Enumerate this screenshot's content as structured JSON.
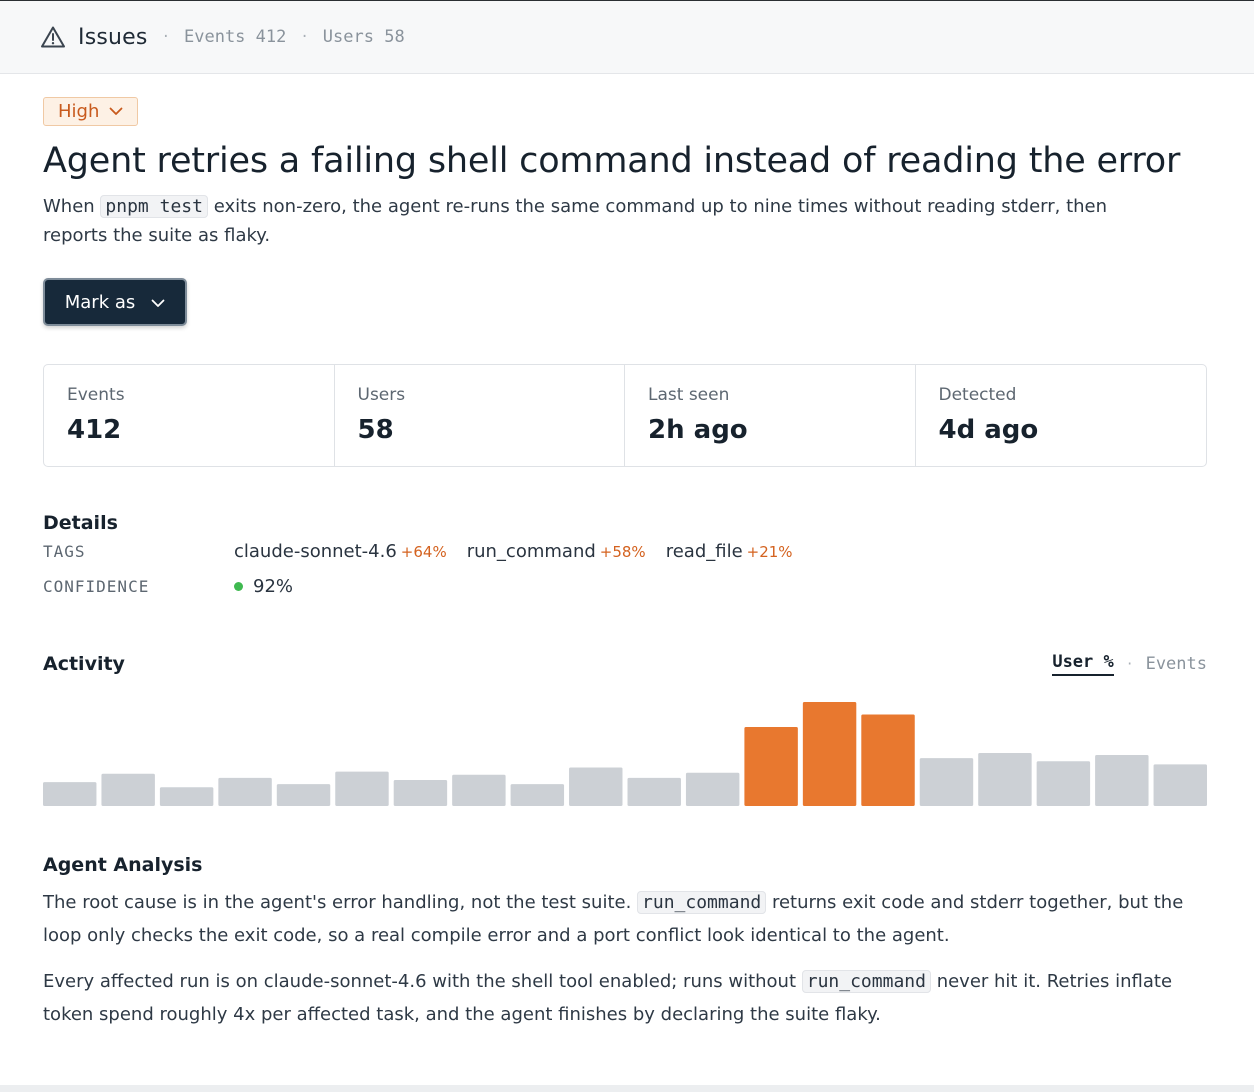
{
  "header": {
    "title": "Issues",
    "events_label": "Events 412",
    "users_label": "Users 58",
    "icon": "warning-triangle-icon"
  },
  "issue": {
    "severity": "High",
    "title": "Agent retries a failing shell command instead of reading the error",
    "desc_before": "When ",
    "desc_code": "pnpm test",
    "desc_after": " exits non-zero, the agent re-runs the same command up to nine times without reading stderr, then reports the suite as flaky.",
    "mark_button": "Mark as"
  },
  "stats": [
    {
      "label": "Events",
      "value": "412"
    },
    {
      "label": "Users",
      "value": "58"
    },
    {
      "label": "Last seen",
      "value": "2h ago"
    },
    {
      "label": "Detected",
      "value": "4d ago"
    }
  ],
  "details": {
    "title": "Details",
    "tags_key": "TAGS",
    "confidence_key": "CONFIDENCE",
    "tags": [
      {
        "name": "claude-sonnet-4.6",
        "pct": "+64%"
      },
      {
        "name": "run_command",
        "pct": "+58%"
      },
      {
        "name": "read_file",
        "pct": "+21%"
      }
    ],
    "confidence": "92%",
    "confidence_color": "#3fb950"
  },
  "activity": {
    "title": "Activity",
    "toggle_active": "User %",
    "toggle_inactive": "Events",
    "colors": {
      "normal": "#ccd0d5",
      "highlight": "#e8782f"
    }
  },
  "chart_data": {
    "type": "bar",
    "values": [
      23,
      31,
      18,
      27,
      21,
      33,
      25,
      30,
      21,
      37,
      27,
      32,
      76,
      100,
      88,
      46,
      51,
      43,
      49,
      40
    ],
    "highlighted": [
      12,
      13,
      14
    ]
  },
  "analysis": {
    "title": "Agent Analysis",
    "p1_before": "The root cause is in the agent's error handling, not the test suite. ",
    "p1_code": "run_command",
    "p1_after": " returns exit code and stderr together, but the loop only checks the exit code, so a real compile error and a port conflict look identical to the agent.",
    "p2_before": "Every affected run is on claude-sonnet-4.6 with the shell tool enabled; runs without ",
    "p2_code": "run_command",
    "p2_after": " never hit it. Retries inflate token spend roughly 4x per affected task, and the agent finishes by declaring the suite flaky."
  }
}
